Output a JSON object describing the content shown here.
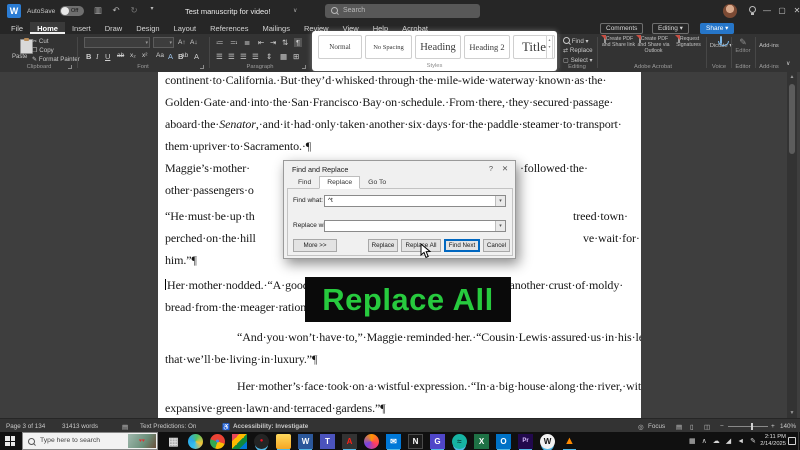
{
  "titlebar": {
    "autosave_label": "AutoSave",
    "autosave_state": "Off",
    "doc_title": "Test manuscritp for video!",
    "search_placeholder": "Search",
    "comments_label": "Comments",
    "editing_label": "Editing",
    "share_label": "Share",
    "share_color": "#2676c9"
  },
  "menu": {
    "tabs": [
      "File",
      "Home",
      "Insert",
      "Draw",
      "Design",
      "Layout",
      "References",
      "Mailings",
      "Review",
      "View",
      "Help",
      "Acrobat"
    ],
    "active_tab": "Home"
  },
  "ribbon": {
    "clipboard": {
      "paste": "Paste",
      "cut": "Cut",
      "copy": "Copy",
      "format_painter": "Format Painter",
      "label": "Clipboard"
    },
    "font": {
      "label": "Font"
    },
    "paragraph": {
      "label": "Paragraph"
    },
    "styles": {
      "label": "Styles",
      "items": [
        "Normal",
        "No Spacing",
        "Heading",
        "Heading 2",
        "Title"
      ]
    },
    "editing": {
      "find": "Find",
      "replace": "Replace",
      "select": "Select",
      "label": "Editing"
    },
    "acrobat": {
      "create_pdf": "Create PDF and Share link",
      "share_outlook": "Create PDF and Share via Outlook",
      "request_signatures": "Request Signatures",
      "label": "Adobe Acrobat"
    },
    "voice": {
      "dictate": "Dictate",
      "label": "Voice"
    },
    "editor": {
      "button": "Editor",
      "label": "Editor"
    },
    "addins": {
      "button": "Add-ins",
      "label": "Add-ins"
    }
  },
  "icons": {
    "save": "▥",
    "undo": "↶",
    "redo": "↻",
    "dropdown": "▾",
    "title_chevron": "∨",
    "min": "—",
    "max": "▢",
    "close": "✕",
    "help": "?",
    "cut": "✂",
    "copy": "❐",
    "format_painter": "✎",
    "bold": "B",
    "italic": "I",
    "underline": "U",
    "strikethrough": "ab",
    "subscript": "x₂",
    "superscript": "x²",
    "grow_font": "A↑",
    "shrink_font": "A↓",
    "change_case": "Aa",
    "text_effects": "A",
    "highlight": "ab",
    "font_color": "A",
    "bullets": "≔",
    "numbering": "≕",
    "multilevel": "≣",
    "outdent": "⇤",
    "indent": "⇥",
    "sort": "⇅",
    "pilcrow": "¶",
    "align": "☰",
    "line_spacing": "⇕",
    "shading": "▦",
    "borders": "⊞",
    "replace_arrows": "⇄",
    "select_box": "▢",
    "collapse": "∨",
    "scroll_up": "▲",
    "scroll_down": "▼",
    "book": "▤",
    "accessibility": "♿",
    "focus": "◎",
    "view_read": "▤",
    "view_print": "▯",
    "view_web": "◫",
    "zoom_minus": "−",
    "zoom_plus": "+"
  },
  "document": {
    "p1l1": "continent·to·California.·But·they’d·whisked·through·the·mile-wide·waterway·known·as·the·",
    "p1l2": "Golden·Gate·and·into·the·San·Francisco·Bay·on·schedule.·From·there,·they·secured·passage·",
    "p1l3_pre": "aboard·the·",
    "p1l3_italic": "Senator",
    "p1l3_post": ",·and·it·had·only·taken·another·six·days·for·the·paddle·steamer·to·transport·",
    "p1l4": "them·upriver·to·Sacramento.·¶",
    "p2l1_left": "Maggie’s·mother·",
    "p2l1_right": "·followed·the·",
    "p2l2": "other·passengers·o",
    "p3l1_left": "“He·must·be·up·th",
    "p3l1_right": "treed·town·",
    "p3l2_left": "perched·on·the·hill",
    "p3l2_right": "ve·wait·for·",
    "p3l3": "him.”¶",
    "p4l1": "Her·mother·nodded.·“A·good·meal·would·be·nice.·I·never·want·to·eat·another·crust·of·moldy·",
    "p4l2": "bread·from·the·meager·rationings·of·a·ship·ever·again.”¶",
    "p5l1": "“And·you·won’t·have·to,”·Maggie·reminded·her.·“Cousin·Lewis·assured·us·in·his·letter·",
    "p5l2": "that·we’ll·be·living·in·luxury.”¶",
    "p6l1": "Her·mother’s·face·took·on·a·wistful·expression.·“In·a·big·house·along·the·river,·with·an·",
    "p6l2": "expansive·green·lawn·and·terraced·gardens.”¶"
  },
  "dialog": {
    "title": "Find and Replace",
    "tabs": {
      "find": "Find",
      "replace": "Replace",
      "goto": "Go To"
    },
    "find_what_label": "Find what:",
    "find_what_value": "^t",
    "replace_with_label": "Replace with:",
    "replace_with_value": "",
    "more_button": "More >>",
    "replace_button": "Replace",
    "replace_all_button": "Replace All",
    "find_next_button": "Find Next",
    "cancel_button": "Cancel"
  },
  "overlay": {
    "text": "Replace All",
    "text_color": "#27ca3e",
    "background": "#0a0a0a"
  },
  "statusbar": {
    "page_indicator": "Page 3 of 134",
    "word_count": "31413 words",
    "text_predictions": "Text Predictions: On",
    "accessibility": "Accessibility: Investigate",
    "focus_label": "Focus",
    "zoom_level": "140%"
  },
  "taskbar": {
    "search_placeholder": "Type here to search",
    "search_image_hint": "♥♥",
    "apps": [
      {
        "name": "task-view-icon",
        "glyph": "▦",
        "style": "color:#dcdcdc;font-size:11px"
      },
      {
        "name": "edge-icon",
        "glyph": "",
        "style": "background:conic-gradient(from 200deg,#35c1f1,#2ba7e8,#52c364,#f6c338,#35c1f1);border-radius:50%"
      },
      {
        "name": "chrome-icon",
        "glyph": "●",
        "style": "background:conic-gradient(#ea4335 0 30%,#fbbc05 30% 55%,#34a853 55% 80%,#ea4335 80%);border-radius:50%;color:#4285f4;font-size:7px"
      },
      {
        "name": "photos-icon",
        "glyph": "",
        "style": "background:linear-gradient(135deg,#e74856 25%,#ffb900 25% 50%,#10893e 50% 75%,#0078d7 75%)"
      },
      {
        "name": "media-player-icon",
        "glyph": "●",
        "style": "background:#242424;border-radius:50%;color:#e81123;font-size:6px;box-shadow:0 3px 0 -1px #51b8e6"
      },
      {
        "name": "file-explorer-icon",
        "glyph": "",
        "style": "background:linear-gradient(#ffd95e,#f5a623);border-radius:2px;box-shadow:0 3px 0 -1px #51b8e6"
      },
      {
        "name": "word-icon",
        "glyph": "W",
        "style": "background:#2b579a;color:#fff;box-shadow:0 3px 0 -1px #51b8e6"
      },
      {
        "name": "teams-icon",
        "glyph": "T",
        "style": "background:#4b53bc;color:#fff"
      },
      {
        "name": "acrobat-icon",
        "glyph": "A",
        "style": "background:#333;color:#ff2116;box-shadow:0 3px 0 -1px #51b8e6"
      },
      {
        "name": "firefox-icon",
        "glyph": "",
        "style": "background:conic-gradient(#ff9500,#ff3b63,#7542e4,#ff9500);border-radius:50%"
      },
      {
        "name": "mail-icon",
        "glyph": "✉",
        "style": "background:#0078d7;color:#fff;font-size:8px;box-shadow:0 3px 0 -1px #51b8e6"
      },
      {
        "name": "notion-icon",
        "glyph": "N",
        "style": "background:#1b1b1b;color:#fff;border:1px solid #4a4a4a"
      },
      {
        "name": "goodnotes-icon",
        "glyph": "G",
        "style": "background:#4f46c8;color:#fff;box-shadow:0 3px 0 -1px #51b8e6"
      },
      {
        "name": "spotify-icon",
        "glyph": "≈",
        "style": "background:#16b3a3;color:#063f38;border-radius:50%;box-shadow:0 3px 0 -1px #51b8e6"
      },
      {
        "name": "excel-icon",
        "glyph": "X",
        "style": "background:#1e7145;color:#fff"
      },
      {
        "name": "outlook-icon",
        "glyph": "O",
        "style": "background:#0072c6;color:#fff;box-shadow:0 3px 0 -1px #51b8e6"
      },
      {
        "name": "premiere-icon",
        "glyph": "Pr",
        "style": "background:#22094d;color:#d6bbff;font-size:6px;box-shadow:0 3px 0 -1px #51b8e6"
      },
      {
        "name": "wikipedia-icon",
        "glyph": "W",
        "style": "background:#f2f2f2;color:#111;border-radius:50%;box-shadow:0 3px 0 -1px #51b8e6"
      },
      {
        "name": "vlc-icon",
        "glyph": "▲",
        "style": "color:#ff8a00;font-size:11px;box-shadow:0 3px 0 -1px #51b8e6"
      }
    ],
    "tray_icons": [
      {
        "name": "touch-keyboard-icon",
        "glyph": "▦"
      },
      {
        "name": "tray-chevron-icon",
        "glyph": "∧"
      },
      {
        "name": "onedrive-icon",
        "glyph": "☁"
      },
      {
        "name": "network-icon",
        "glyph": "◢"
      },
      {
        "name": "volume-icon",
        "glyph": "◄"
      },
      {
        "name": "pen-icon",
        "glyph": "✎"
      }
    ],
    "time": "2:11 PM",
    "date": "2/14/2025"
  }
}
